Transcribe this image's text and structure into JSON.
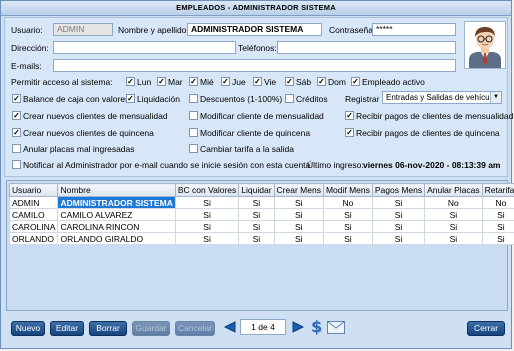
{
  "window": {
    "title": "EMPLEADOS - ADMINISTRADOR SISTEMA"
  },
  "form": {
    "usuario_label": "Usuario:",
    "usuario_value": "ADMIN",
    "nombre_label": "Nombre y apellido:",
    "nombre_value": "ADMINISTRADOR SISTEMA",
    "contrasena_label": "Contraseña:",
    "contrasena_value": "*****",
    "direccion_label": "Dirección:",
    "direccion_value": "",
    "telefonos_label": "Teléfonos:",
    "telefonos_value": "",
    "emails_label": "E-mails:",
    "emails_value": ""
  },
  "access": {
    "label": "Permitir acceso al sistema:",
    "days": [
      {
        "label": "Lun",
        "checked": true
      },
      {
        "label": "Mar",
        "checked": true
      },
      {
        "label": "Mié",
        "checked": true
      },
      {
        "label": "Jue",
        "checked": true
      },
      {
        "label": "Vie",
        "checked": true
      },
      {
        "label": "Sáb",
        "checked": true
      },
      {
        "label": "Dom",
        "checked": true
      }
    ],
    "empleado_activo": {
      "label": "Empleado activo",
      "checked": true
    }
  },
  "permissions": {
    "balance": {
      "label": "Balance de caja con valores",
      "checked": true
    },
    "liquidacion": {
      "label": "Liquidación",
      "checked": true
    },
    "descuentos": {
      "label": "Descuentos (1-100%)",
      "checked": false
    },
    "creditos": {
      "label": "Créditos",
      "checked": false
    },
    "registrar_label": "Registrar",
    "registrar_value": "Entradas y Salidas de vehículos",
    "crear_mensualidad": {
      "label": "Crear nuevos clientes de mensualidad",
      "checked": true
    },
    "modificar_mensualidad": {
      "label": "Modificar cliente de mensualidad",
      "checked": false
    },
    "recibir_mensualidad": {
      "label": "Recibir pagos de clientes de mensualidad",
      "checked": true
    },
    "crear_quincena": {
      "label": "Crear nuevos clientes de quincena",
      "checked": true
    },
    "modificar_quincena": {
      "label": "Modificar cliente de quincena",
      "checked": false
    },
    "recibir_quincena": {
      "label": "Recibir pagos de clientes de quincena",
      "checked": true
    },
    "anular_placas": {
      "label": "Anular placas mal ingresadas",
      "checked": false
    },
    "cambiar_tarifa": {
      "label": "Cambiar tarifa a la salida",
      "checked": false
    },
    "notificar": {
      "label": "Notificar al Administrador por e-mail cuando se inicie sesión con esta cuenta",
      "checked": false
    },
    "ultimo_ingreso_label": "Último ingreso:",
    "ultimo_ingreso_value": "viernes 06-nov-2020 - 08:13:39 am"
  },
  "table": {
    "headers": [
      "Usuario",
      "Nombre",
      "BC con Valores",
      "Liquidar",
      "Crear Mens",
      "Modif Mens",
      "Pagos Mens",
      "Anular Placas",
      "Retarifar"
    ],
    "rows": [
      [
        "ADMIN",
        "ADMINISTRADOR SISTEMA",
        "Si",
        "Si",
        "Si",
        "No",
        "Si",
        "No",
        "No"
      ],
      [
        "CAMILO",
        "CAMILO ALVAREZ",
        "Si",
        "Si",
        "Si",
        "Si",
        "Si",
        "Si",
        "Si"
      ],
      [
        "CAROLINA",
        "CAROLINA RINCON",
        "Si",
        "Si",
        "Si",
        "Si",
        "Si",
        "Si",
        "Si"
      ],
      [
        "ORLANDO",
        "ORLANDO GIRALDO",
        "Si",
        "Si",
        "Si",
        "Si",
        "Si",
        "Si",
        "Si"
      ]
    ]
  },
  "toolbar": {
    "nuevo": "Nuevo",
    "editar": "Editar",
    "borrar": "Borrar",
    "guardar": "Guardar",
    "cancelar": "Cancelar",
    "page": "1 de 4",
    "cerrar": "Cerrar"
  },
  "colors": {
    "accent": "#1e78d6",
    "button": "#1c4f8c",
    "panel": "#d8e7f7"
  }
}
